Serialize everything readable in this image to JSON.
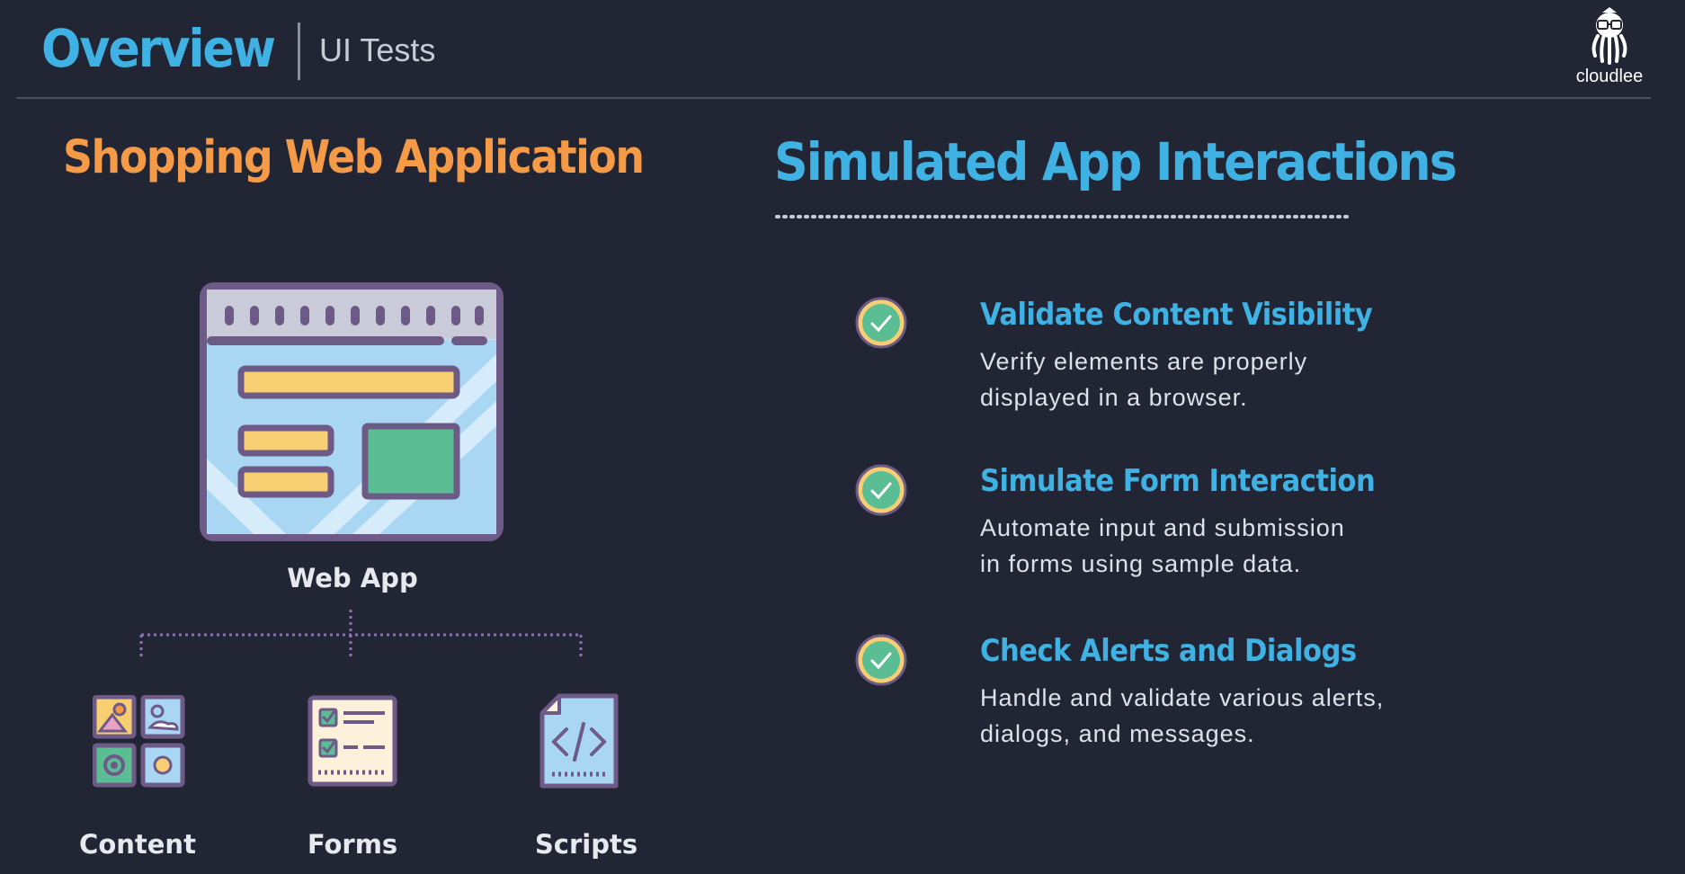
{
  "header": {
    "title": "Overview",
    "subtitle": "UI Tests",
    "brand": "cloudlee"
  },
  "left": {
    "heading": "Shopping Web Application",
    "root_label": "Web App",
    "children": [
      {
        "label": "Content",
        "icon": "image-grid-icon"
      },
      {
        "label": "Forms",
        "icon": "form-checklist-icon"
      },
      {
        "label": "Scripts",
        "icon": "code-file-icon"
      }
    ]
  },
  "right": {
    "heading": "Simulated App Interactions",
    "items": [
      {
        "title": "Validate Content Visibility",
        "desc_line1": "Verify elements are properly",
        "desc_line2": "displayed in a browser."
      },
      {
        "title": "Simulate Form Interaction",
        "desc_line1": "Automate input and submission",
        "desc_line2": "in forms using sample data."
      },
      {
        "title": "Check Alerts and Dialogs",
        "desc_line1": "Handle and validate various alerts,",
        "desc_line2": "dialogs, and messages."
      }
    ]
  },
  "colors": {
    "background": "#222634",
    "accent_blue": "#3fb1e3",
    "accent_orange": "#f59a46",
    "icon_purple": "#6e5a86",
    "icon_green": "#5bbd94",
    "icon_yellow": "#f7cf72"
  }
}
